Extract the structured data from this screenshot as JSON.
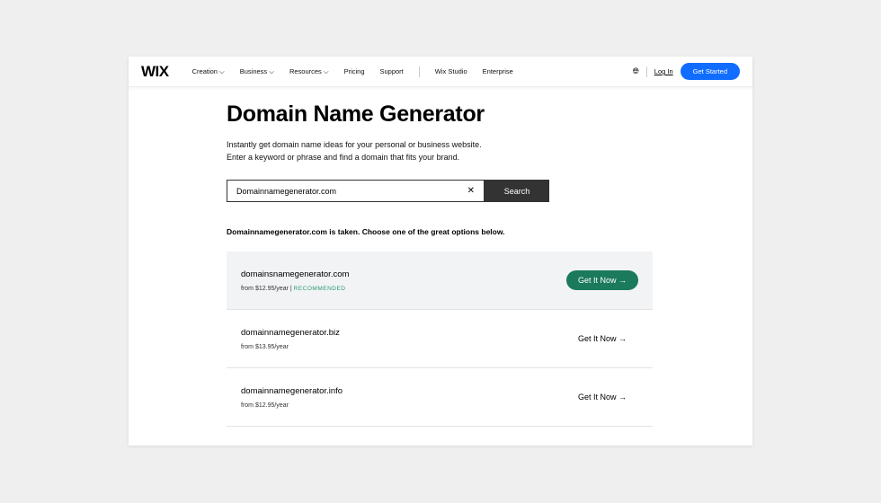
{
  "nav": {
    "logo": "WIX",
    "items": [
      "Creation ⌵",
      "Business ⌵",
      "Resources ⌵",
      "Pricing",
      "Support"
    ],
    "items2": [
      "Wix Studio",
      "Enterprise"
    ],
    "login": "Log In",
    "get_started": "Get Started",
    "accent": "#116dff"
  },
  "main": {
    "title": "Domain Name Generator",
    "sub1": "Instantly get domain name ideas for your personal or business website.",
    "sub2": "Enter a keyword or phrase and find a domain that fits your brand.",
    "search_value": "Domainnamegenerator.com",
    "search_label": "Search",
    "taken": "Domainnamegenerator.com is taken. Choose one of the great options below.",
    "results": [
      {
        "domain": "domainsnamegenerator.com",
        "price": "from $12.95/year",
        "badge": "RECOMMENDED",
        "cta": "Get It Now →"
      },
      {
        "domain": "domainnamegenerator.biz",
        "price": "from $13.95/year",
        "cta": "Get It Now →"
      },
      {
        "domain": "domainnamegenerator.info",
        "price": "from $12.95/year",
        "cta": "Get It Now →"
      }
    ]
  }
}
